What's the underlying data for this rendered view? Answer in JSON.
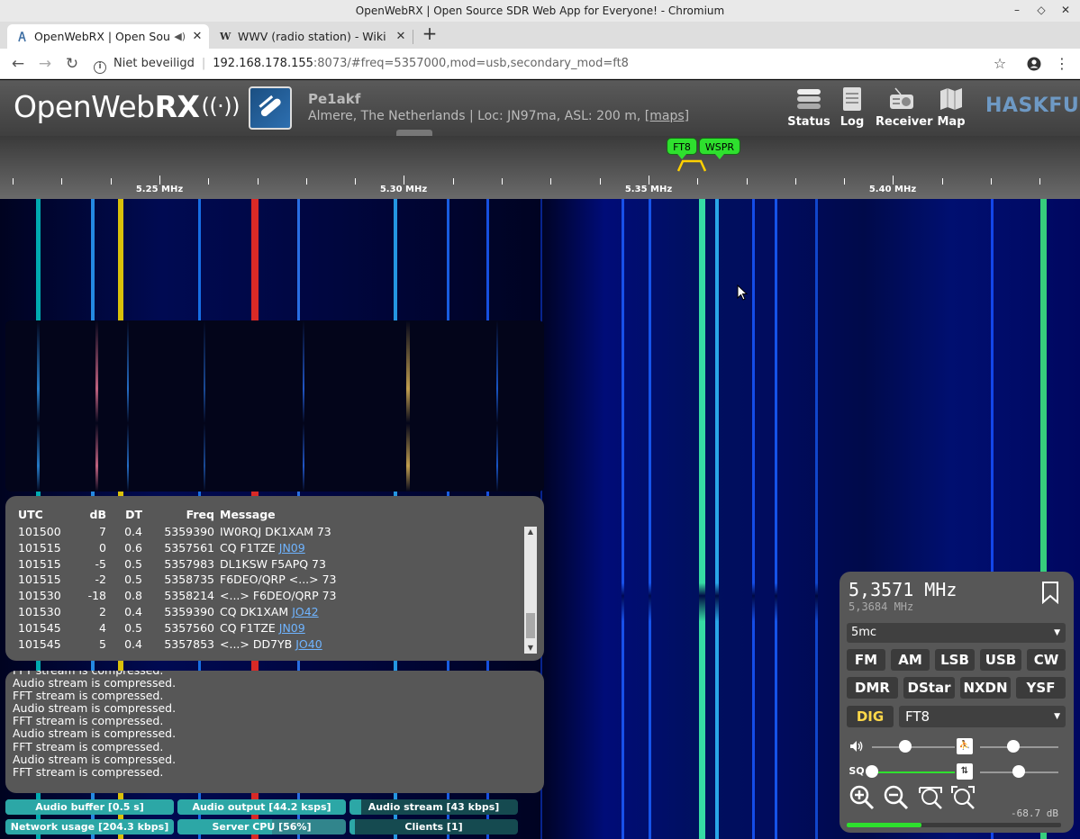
{
  "window": {
    "title": "OpenWebRX | Open Source SDR Web App for Everyone! - Chromium",
    "min": "–",
    "max": "◇",
    "close": "✕"
  },
  "tabs": [
    {
      "title": "OpenWebRX | Open Sou",
      "icon": "openwebrx-favicon",
      "close": "✕"
    },
    {
      "title": "WWV (radio station) - Wiki",
      "icon": "wikipedia-favicon",
      "favicon_text": "W",
      "close": "✕"
    }
  ],
  "new_tab": "+",
  "address_bar": {
    "security_label": "Niet beveiligd",
    "host": "192.168.178.155",
    "rest": ":8073/#freq=5357000,mod=usb,secondary_mod=ft8"
  },
  "header": {
    "logo_light": "OpenWeb",
    "logo_bold": "RX",
    "logo_waves": "((·))",
    "receiver_name": "Pe1akf",
    "receiver_location": "Almere, The Netherlands | Loc: JN97ma, ASL: 200 m,",
    "maps_link": "[maps]",
    "buttons": [
      {
        "label": "Status",
        "icon": "status-icon"
      },
      {
        "label": "Log",
        "icon": "log-icon"
      },
      {
        "label": "Receiver",
        "icon": "receiver-icon"
      },
      {
        "label": "Map",
        "icon": "map-icon"
      }
    ],
    "sponsor": "HASKFU"
  },
  "scale": {
    "labels": [
      {
        "text": "5.25 MHz",
        "mhz": 5.25
      },
      {
        "text": "5.30 MHz",
        "mhz": 5.3
      },
      {
        "text": "5.35 MHz",
        "mhz": 5.35
      },
      {
        "text": "5.40 MHz",
        "mhz": 5.4
      }
    ],
    "bookmarks": [
      {
        "text": "FT8"
      },
      {
        "text": "WSPR"
      }
    ]
  },
  "messages": {
    "headers": {
      "utc": "UTC",
      "db": "dB",
      "dt": "DT",
      "freq": "Freq",
      "message": "Message"
    },
    "rows": [
      {
        "utc": "101500",
        "db": "7",
        "dt": "0.4",
        "freq": "5359390",
        "msg": "IW0RQJ DK1XAM 73",
        "loc": ""
      },
      {
        "utc": "101515",
        "db": "0",
        "dt": "0.6",
        "freq": "5357561",
        "msg": "CQ F1TZE",
        "loc": "JN09"
      },
      {
        "utc": "101515",
        "db": "-5",
        "dt": "0.5",
        "freq": "5357983",
        "msg": "DL1KSW F5APQ 73",
        "loc": ""
      },
      {
        "utc": "101515",
        "db": "-2",
        "dt": "0.5",
        "freq": "5358735",
        "msg": "F6DEO/QRP <...> 73",
        "loc": ""
      },
      {
        "utc": "101530",
        "db": "-18",
        "dt": "0.8",
        "freq": "5358214",
        "msg": "<...> F6DEO/QRP 73",
        "loc": ""
      },
      {
        "utc": "101530",
        "db": "2",
        "dt": "0.4",
        "freq": "5359390",
        "msg": "CQ DK1XAM",
        "loc": "JO42"
      },
      {
        "utc": "101545",
        "db": "4",
        "dt": "0.5",
        "freq": "5357560",
        "msg": "CQ F1TZE",
        "loc": "JN09"
      },
      {
        "utc": "101545",
        "db": "5",
        "dt": "0.4",
        "freq": "5357853",
        "msg": "<...> DD7YB",
        "loc": "JO40"
      }
    ]
  },
  "log": {
    "lines": [
      "FFT stream is compressed.",
      "Audio stream is compressed.",
      "FFT stream is compressed.",
      "Audio stream is compressed.",
      "FFT stream is compressed.",
      "Audio stream is compressed.",
      "FFT stream is compressed.",
      "Audio stream is compressed.",
      "FFT stream is compressed."
    ]
  },
  "status_bars": [
    {
      "label": "Audio buffer [0.5 s]",
      "fill": 1.0
    },
    {
      "label": "Audio output [44.2 ksps]",
      "fill": 1.0
    },
    {
      "label": "Audio stream [43 kbps]",
      "fill": 0.07
    },
    {
      "label": "Network usage [204.3 kbps]",
      "fill": 1.0
    },
    {
      "label": "Server CPU [56%]",
      "fill": 0.56
    },
    {
      "label": "Clients [1]",
      "fill": 0.03
    }
  ],
  "receiver": {
    "frequency": "5,3571 MHz",
    "secondary_frequency": "5,3684 MHz",
    "profile": "5mc",
    "modes_row1": [
      "FM",
      "AM",
      "LSB",
      "USB",
      "CW"
    ],
    "modes_row2": [
      "DMR",
      "DStar",
      "NXDN",
      "YSF"
    ],
    "dig_label": "DIG",
    "dig_mode": "FT8",
    "squelch_label": "SQ",
    "volume": 0.4,
    "squelch": 0.0,
    "smeter_text": "-68.7 dB",
    "smeter_level": 0.35,
    "colors": {
      "dig_active": "#ffd84a",
      "bookmark": "#2ee02e"
    }
  }
}
